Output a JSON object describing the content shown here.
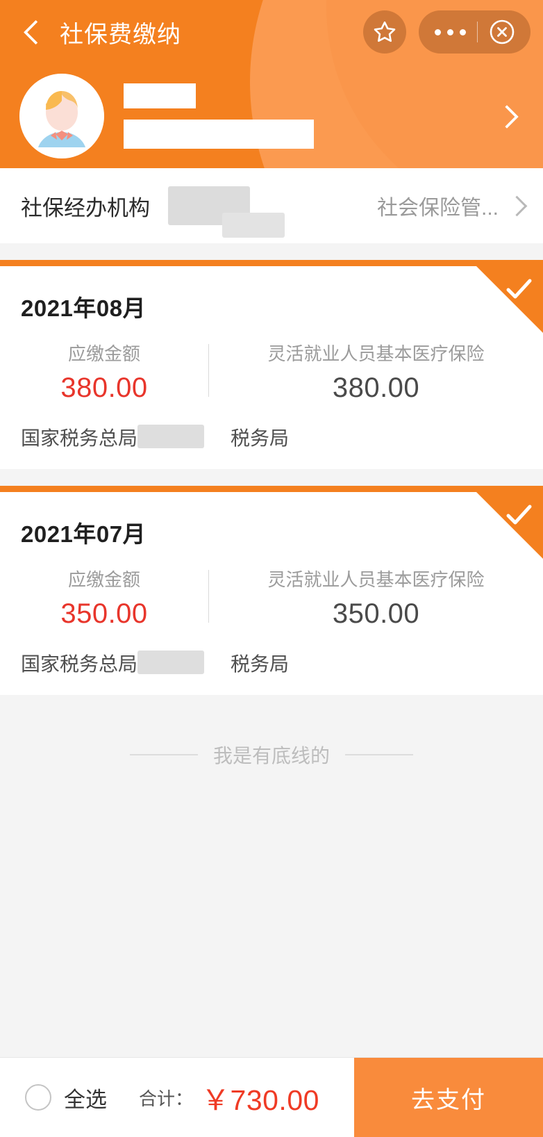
{
  "header": {
    "back_icon": "back-chevron-icon",
    "title": "社保费缴纳",
    "favorite_icon": "star-icon",
    "more_icon": "more-dots-icon",
    "close_icon": "close-circle-icon",
    "user_chevron_icon": "chevron-right-icon",
    "avatar_icon": "user-avatar-icon",
    "accent_color": "#f4801f",
    "arc_color": "#fb9a50"
  },
  "agency": {
    "label": "社保经办机构",
    "value": "社会保险管...",
    "chevron_icon": "chevron-right-icon"
  },
  "cards": [
    {
      "month": "2021年08月",
      "amount_label": "应缴金额",
      "amount_value": "380.00",
      "item_label": "灵活就业人员基本医疗保险",
      "item_value": "380.00",
      "authority": "国家税务总局",
      "bureau": "税务局",
      "selected": true,
      "check_icon": "check-icon"
    },
    {
      "month": "2021年07月",
      "amount_label": "应缴金额",
      "amount_value": "350.00",
      "item_label": "灵活就业人员基本医疗保险",
      "item_value": "350.00",
      "authority": "国家税务总局",
      "bureau": "税务局",
      "selected": true,
      "check_icon": "check-icon"
    }
  ],
  "list_end": {
    "text": "我是有底线的"
  },
  "bottom_bar": {
    "checkbox_icon": "circle-checkbox-icon",
    "select_all_label": "全选",
    "total_label": "合计：",
    "total_value": "￥730.00",
    "pay_button_label": "去支付",
    "total_color": "#ef3b25",
    "pay_button_color": "#f98b3c"
  }
}
